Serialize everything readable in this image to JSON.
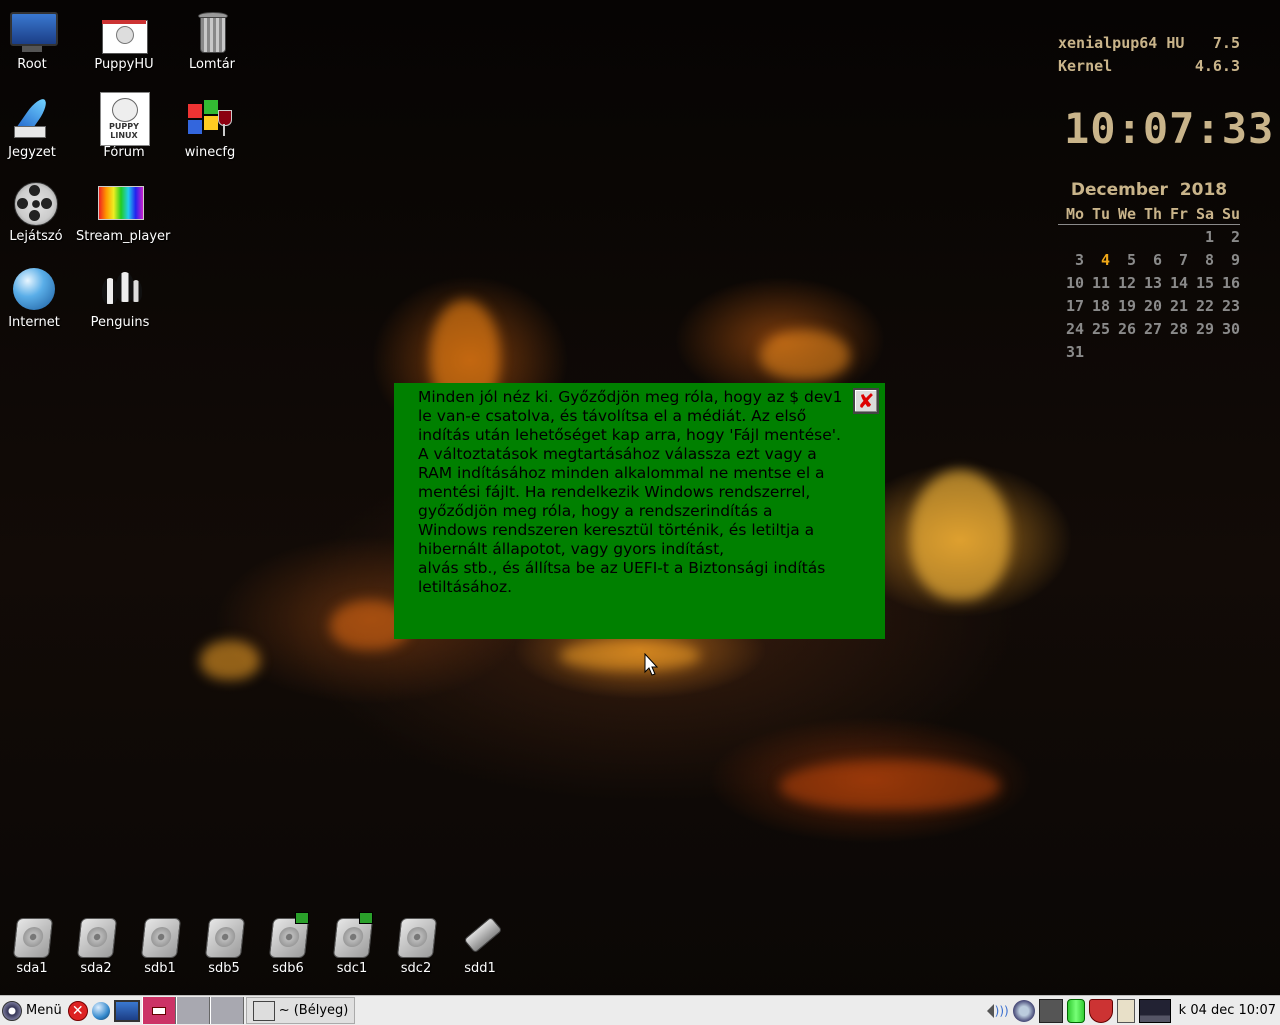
{
  "desktop_icons": [
    {
      "label": "Root",
      "icon": "monitor-icon"
    },
    {
      "label": "PuppyHU",
      "icon": "puppyhu-icon"
    },
    {
      "label": "Lomtár",
      "icon": "trash-icon"
    },
    {
      "label": "Jegyzet",
      "icon": "quill-icon"
    },
    {
      "label": "Fórum",
      "icon": "puppy-linux-icon",
      "icon_text": "PUPPY LINUX"
    },
    {
      "label": "winecfg",
      "icon": "windows-wine-icon"
    },
    {
      "label": "Lejátszó",
      "icon": "film-reel-icon"
    },
    {
      "label": "Stream_player",
      "icon": "spectrum-icon"
    },
    {
      "label": "Internet",
      "icon": "globe-icon"
    },
    {
      "label": "Penguins",
      "icon": "penguins-icon"
    }
  ],
  "drives": [
    {
      "label": "sda1",
      "mounted": false
    },
    {
      "label": "sda2",
      "mounted": false
    },
    {
      "label": "sdb1",
      "mounted": false
    },
    {
      "label": "sdb5",
      "mounted": false
    },
    {
      "label": "sdb6",
      "mounted": true
    },
    {
      "label": "sdc1",
      "mounted": true
    },
    {
      "label": "sdc2",
      "mounted": false
    },
    {
      "label": "sdd1",
      "mounted": false,
      "icon": "usb-drive-icon"
    }
  ],
  "conky": {
    "system_name": "xenialpup64 HU",
    "system_version": "7.5",
    "kernel_label": "Kernel",
    "kernel_version": "4.6.3",
    "clock": "10:07:33",
    "calendar": {
      "month": "December",
      "year": "2018",
      "weekdays": [
        "Mo",
        "Tu",
        "We",
        "Th",
        "Fr",
        "Sa",
        "Su"
      ],
      "weeks": [
        [
          "",
          "",
          "",
          "",
          "",
          "1",
          "2"
        ],
        [
          "3",
          "4",
          "5",
          "6",
          "7",
          "8",
          "9"
        ],
        [
          "10",
          "11",
          "12",
          "13",
          "14",
          "15",
          "16"
        ],
        [
          "17",
          "18",
          "19",
          "20",
          "21",
          "22",
          "23"
        ],
        [
          "24",
          "25",
          "26",
          "27",
          "28",
          "29",
          "30"
        ],
        [
          "31",
          "",
          "",
          "",
          "",
          "",
          ""
        ]
      ],
      "today": "4"
    }
  },
  "message": {
    "text": "Minden jól néz ki. Győződjön meg róla, hogy az $ dev1 le van-e csatolva, és távolítsa el a médiát. Az első indítás után lehetőséget kap arra, hogy 'Fájl mentése'. A változtatások megtartásához válassza ezt vagy a RAM indításához minden alkalommal ne mentse el a mentési fájlt. Ha rendelkezik Windows rendszerrel, győződjön meg róla, hogy a rendszerindítás a Windows rendszeren keresztül történik, és letiltja a hibernált állapotot, vagy gyors indítást,\nalvás stb., és állítsa be az UEFI-t a Biztonsági indítás letiltásához.",
    "bg_color": "#008000"
  },
  "taskbar": {
    "menu_label": "Menü",
    "window_title": "~ (Bélyeg)",
    "datetime": "k 04 dec 10:07"
  }
}
